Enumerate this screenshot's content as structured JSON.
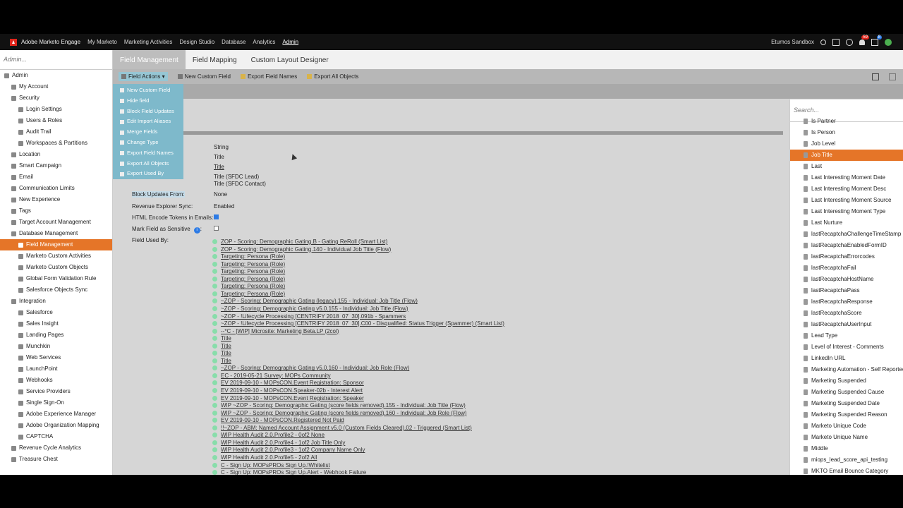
{
  "topnav": {
    "brand": "Adobe Marketo Engage",
    "items": [
      "My Marketo",
      "Marketing Activities",
      "Design Studio",
      "Database",
      "Analytics",
      "Admin"
    ],
    "active": "Admin",
    "workspace": "Etumos Sandbox",
    "notif_count": "59",
    "help_count": "8"
  },
  "sidebar": {
    "search_placeholder": "Admin...",
    "items": [
      {
        "label": "Admin",
        "indent": 0
      },
      {
        "label": "My Account",
        "indent": 1
      },
      {
        "label": "Security",
        "indent": 1
      },
      {
        "label": "Login Settings",
        "indent": 2
      },
      {
        "label": "Users & Roles",
        "indent": 2
      },
      {
        "label": "Audit Trail",
        "indent": 2
      },
      {
        "label": "Workspaces & Partitions",
        "indent": 2
      },
      {
        "label": "Location",
        "indent": 1
      },
      {
        "label": "Smart Campaign",
        "indent": 1
      },
      {
        "label": "Email",
        "indent": 1
      },
      {
        "label": "Communication Limits",
        "indent": 1
      },
      {
        "label": "New Experience",
        "indent": 1
      },
      {
        "label": "Tags",
        "indent": 1
      },
      {
        "label": "Target Account Management",
        "indent": 1
      },
      {
        "label": "Database Management",
        "indent": 1
      },
      {
        "label": "Field Management",
        "indent": 2,
        "selected": true
      },
      {
        "label": "Marketo Custom Activities",
        "indent": 2
      },
      {
        "label": "Marketo Custom Objects",
        "indent": 2
      },
      {
        "label": "Global Form Validation Rule",
        "indent": 2
      },
      {
        "label": "Salesforce Objects Sync",
        "indent": 2
      },
      {
        "label": "Integration",
        "indent": 1
      },
      {
        "label": "Salesforce",
        "indent": 2
      },
      {
        "label": "Sales Insight",
        "indent": 2
      },
      {
        "label": "Landing Pages",
        "indent": 2
      },
      {
        "label": "Munchkin",
        "indent": 2
      },
      {
        "label": "Web Services",
        "indent": 2
      },
      {
        "label": "LaunchPoint",
        "indent": 2
      },
      {
        "label": "Webhooks",
        "indent": 2
      },
      {
        "label": "Service Providers",
        "indent": 2
      },
      {
        "label": "Single Sign-On",
        "indent": 2
      },
      {
        "label": "Adobe Experience Manager",
        "indent": 2
      },
      {
        "label": "Adobe Organization Mapping",
        "indent": 2
      },
      {
        "label": "CAPTCHA",
        "indent": 2
      },
      {
        "label": "Revenue Cycle Analytics",
        "indent": 1
      },
      {
        "label": "Treasure Chest",
        "indent": 1
      }
    ]
  },
  "tabs": [
    "Field Management",
    "Field Mapping",
    "Custom Layout Designer"
  ],
  "toolbar": {
    "field_actions": "Field Actions",
    "new_custom_field": "New Custom Field",
    "export_field_names": "Export Field Names",
    "export_all_objects": "Export All Objects"
  },
  "menu": [
    "New Custom Field",
    "Hide field",
    "Block Field Updates",
    "Edit Import Aliases",
    "Merge Fields",
    "Change Type",
    "Export Field Names",
    "Export All Objects",
    "Export Used By"
  ],
  "detail": {
    "type_value": "String",
    "name_value": "Title",
    "api_value": "Title",
    "sfdc_lead": "Title (SFDC Lead)",
    "sfdc_contact": "Title (SFDC Contact)",
    "block_label": "Block Updates From:",
    "block_value": "None",
    "res_label": "Revenue Explorer Sync:",
    "res_value": "Enabled",
    "html_label": "HTML Encode Tokens in Emails:",
    "sensitive_label": "Mark Field as Sensitive",
    "used_label": "Field Used By:",
    "used_by": [
      "ZOP - Scoring: Demographic Gating.B - Gating ReRoll (Smart List)",
      "ZOP - Scoring: Demographic Gating.140 - Individual Job Title (Flow)",
      "Targeting: Persona (Role)",
      "Targeting: Persona (Role)",
      "Targeting: Persona (Role)",
      "Targeting: Persona (Role)",
      "Targeting: Persona (Role)",
      "Targeting: Persona (Role)",
      "~ZOP - Scoring: Demographic Gating (legacy).155 - Individual: Job Title (Flow)",
      "~ZOP - Scoring: Demographic Gating v5.0.155 - Individual: Job Title (Flow)",
      "~ZOP - !Lifecycle Processing [CENTRIFY 2018_07_30].091b - Spammers",
      "~ZOP - !Lifecycle Processing [CENTRIFY 2018_07_30].C00 - Disqualified: Status Trigger (Spammer) (Smart List)",
      "--*C - [WIP] Microsite: Marketing Beta.LP (2col)",
      "Title",
      "Title",
      "Title",
      "Title",
      "~ZOP - Scoring: Demographic Gating v5.0.160 - Individual: Job Role (Flow)",
      "EC - 2019-05-21 Survey: MOPs Community",
      "EV 2019-09-10 - MOPsCON.Event Registration: Sponsor",
      "EV 2019-09-10 - MOPsCON.Speaker-02b - Interest Alert",
      "EV 2019-09-10 - MOPsCON.Event Registration: Speaker",
      "WIP ~ZOP - Scoring: Demographic Gating (score fields removed).155 - Individual: Job Title (Flow)",
      "WIP ~ZOP - Scoring: Demographic Gating (score fields removed).160 - Individual: Job Role (Flow)",
      "EV 2019-09-10 - MOPsCON.Registered Not Paid",
      "!!~ZOP - ABM: Named Account Assignment v5.0 (Custom Fields Cleared).02 - Triggered (Smart List)",
      "WIP Health Audit 2.0.Profile2 - 0of2 None",
      "WIP Health Audit 2.0.Profile4 - 1of2 Job Title Only",
      "WIP Health Audit 2.0.Profile3 - 1of2 Company Name Only",
      "WIP Health Audit 2.0.Profile5 - 2of2 All",
      "C - Sign Up: MOPsPROs Sign Up.!Whitelist",
      "C - Sign Up: MOPsPROs Sign Up.Alert - Webhook Failure"
    ]
  },
  "rightpanel": {
    "search_placeholder": "Search...",
    "items": [
      "Is Partner",
      "Is Person",
      "Job Level",
      "Job Title",
      "Last",
      "Last Interesting Moment Date",
      "Last Interesting Moment Desc",
      "Last Interesting Moment Source",
      "Last Interesting Moment Type",
      "Last Nurture",
      "lastRecaptchaChallengeTimeStamp",
      "lastRecaptchaEnabledFormID",
      "lastRecaptchaErrorcodes",
      "lastRecaptchaFail",
      "lastRecaptchaHostName",
      "lastRecaptchaPass",
      "lastRecaptchaResponse",
      "lastRecaptchaScore",
      "lastRecaptchaUserInput",
      "Lead Type",
      "Level of Interest - Comments",
      "LinkedIn URL",
      "Marketing Automation - Self Reported",
      "Marketing Suspended",
      "Marketing Suspended Cause",
      "Marketing Suspended Date",
      "Marketing Suspended Reason",
      "Marketo Unique Code",
      "Marketo Unique Name",
      "Middle",
      "miops_lead_score_api_testing",
      "MKTO Email Bounce Category"
    ],
    "selected": "Job Title"
  },
  "colors": {
    "accent": "#e57528",
    "menu": "#7eb9cb",
    "link": "#2d7be5"
  }
}
